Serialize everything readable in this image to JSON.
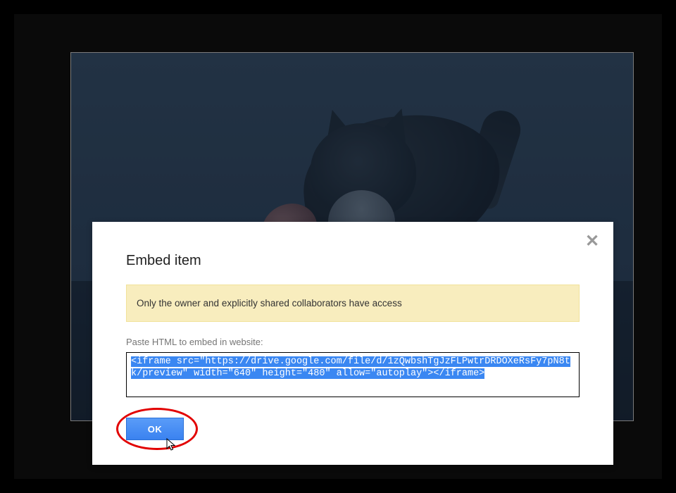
{
  "dialog": {
    "title": "Embed item",
    "notice": "Only the owner and explicitly shared collaborators have access",
    "embed_label": "Paste HTML to embed in website:",
    "embed_code": "<iframe src=\"https://drive.google.com/file/d/1zQwbshTgJzFLPwtrDRDOXeRsFy7pN8tk/preview\" width=\"640\" height=\"480\" allow=\"autoplay\"></iframe>",
    "ok_label": "OK",
    "close_label": "✕"
  }
}
